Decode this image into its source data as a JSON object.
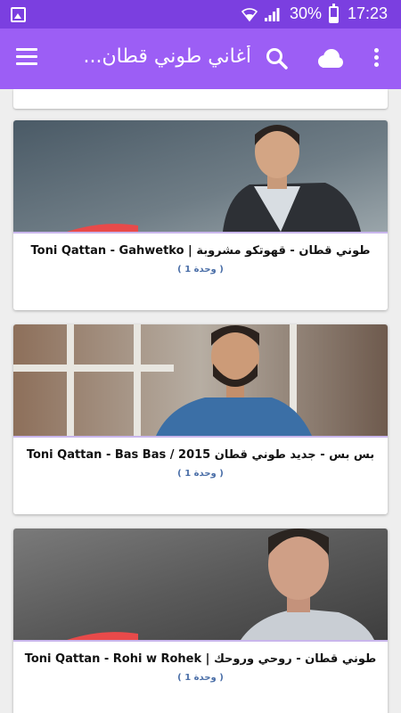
{
  "status_bar": {
    "battery_percent": "30%",
    "time": "17:23"
  },
  "app_bar": {
    "title": "أغاني طوني قطان...",
    "icons": [
      "menu-icon",
      "search-icon",
      "cloud-icon",
      "more-vert-icon"
    ]
  },
  "colors": {
    "status_bar": "#7b3fe0",
    "app_bar": "#9c5ef5",
    "background": "#eeeeee",
    "count_text": "#4b6fa8",
    "divider": "#c9b6ec"
  },
  "songs": [
    {
      "title": "طوني قطان - قهوتكو مشروبة | Toni Qattan - Gahwetko",
      "count": "( 1 وحدة )"
    },
    {
      "title": "بس بس - جديد طوني قطان 2015 / Toni Qattan - Bas Bas",
      "count": "( 1 وحدة )"
    },
    {
      "title": "طوني قطان - روحي وروحك | Toni Qattan - Rohi w Rohek",
      "count": "( 1 وحدة )"
    }
  ]
}
